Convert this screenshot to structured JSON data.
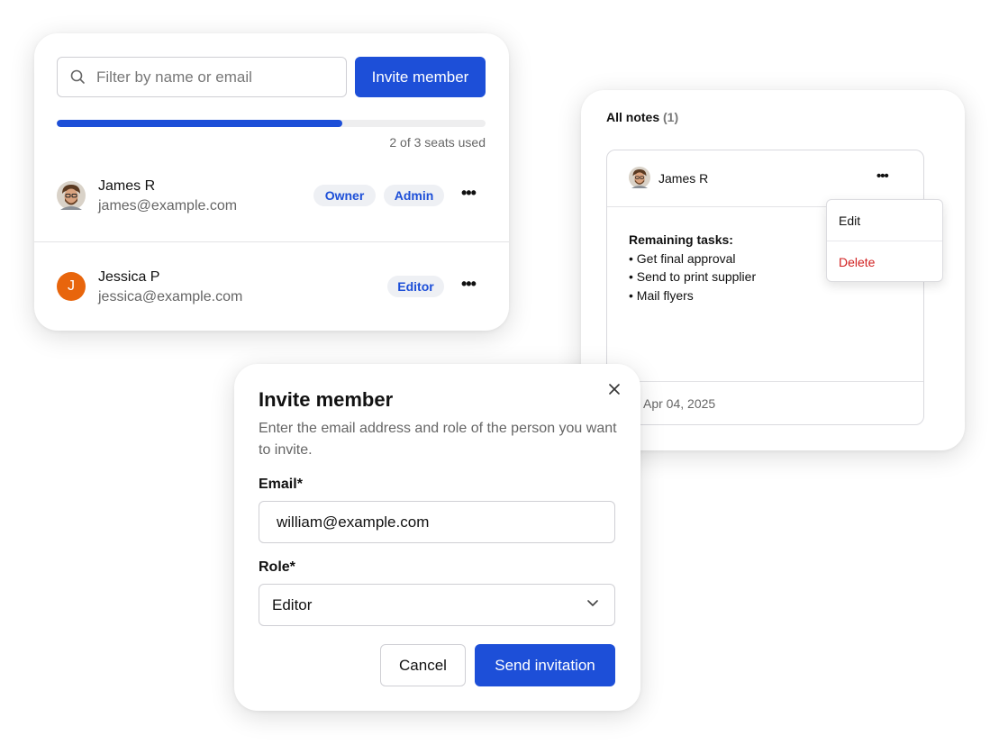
{
  "members_panel": {
    "search": {
      "placeholder": "Filter by name or email",
      "icon": "search-icon"
    },
    "invite_button": "Invite member",
    "seats": {
      "used": 2,
      "total": 3,
      "label": "2 of 3 seats used"
    },
    "accent_color": "#1d4fd8",
    "members": [
      {
        "name": "James R",
        "email": "james@example.com",
        "badges": [
          "Owner",
          "Admin"
        ],
        "avatar": "photo"
      },
      {
        "name": "Jessica P",
        "email": "jessica@example.com",
        "badges": [
          "Editor"
        ],
        "avatar_initial": "J",
        "avatar_color": "#e8650c"
      }
    ]
  },
  "notes_panel": {
    "title": "All notes",
    "count": "(1)",
    "note": {
      "author": "James R",
      "heading": "Remaining tasks:",
      "items": [
        "Get final approval",
        "Send to print supplier",
        "Mail flyers"
      ],
      "date": "Apr 04, 2025"
    },
    "menu": {
      "edit": "Edit",
      "delete": "Delete",
      "delete_color": "#d12020"
    }
  },
  "invite_modal": {
    "title": "Invite member",
    "description": "Enter the email address and role of the person you want to invite.",
    "email_label": "Email*",
    "email_value": "william@example.com",
    "role_label": "Role*",
    "role_value": "Editor",
    "cancel": "Cancel",
    "send": "Send invitation"
  }
}
